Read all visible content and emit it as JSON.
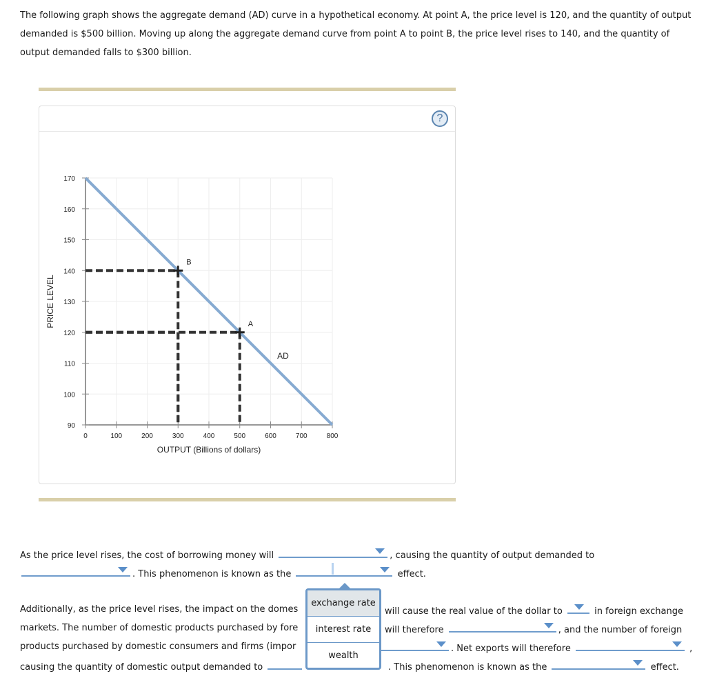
{
  "intro": {
    "lines": [
      "The following graph shows the aggregate demand (AD) curve in a hypothetical economy. At point A, the price level is 120, and the quantity of output",
      "demanded is $500 billion. Moving up along the aggregate demand curve from point A to point B, the price level rises to 140, and the quantity of",
      "output demanded falls to $300 billion."
    ]
  },
  "graph": {
    "help_icon": "question-circle-icon",
    "help_label": "?"
  },
  "chart_data": {
    "type": "line",
    "title": "",
    "xlabel": "OUTPUT (Billions of dollars)",
    "ylabel": "PRICE LEVEL",
    "xlim": [
      0,
      800
    ],
    "ylim": [
      90,
      170
    ],
    "x_ticks": [
      0,
      100,
      200,
      300,
      400,
      500,
      600,
      700,
      800
    ],
    "y_ticks": [
      90,
      100,
      110,
      120,
      130,
      140,
      150,
      160,
      170
    ],
    "grid": true,
    "series": [
      {
        "name": "AD",
        "label": "AD",
        "color": "#86aad1",
        "x": [
          0,
          800
        ],
        "y": [
          170,
          90
        ],
        "label_at": [
          640,
          111
        ]
      }
    ],
    "points": [
      {
        "name": "A",
        "x": 500,
        "y": 120
      },
      {
        "name": "B",
        "x": 300,
        "y": 140
      }
    ],
    "guides": [
      {
        "x": 300,
        "y": 140
      },
      {
        "x": 500,
        "y": 120
      },
      {
        "x": 300,
        "y": 120
      }
    ]
  },
  "question1": {
    "line1_pre": "As the price level rises, the cost of borrowing money will",
    "line1_post": ", causing the quantity of output demanded to",
    "line2_mid": ". This phenomenon is known as the",
    "line2_post": "effect.",
    "dropdowns": [
      {
        "id": "borrowing-cost",
        "value": ""
      },
      {
        "id": "quantity-demanded",
        "value": ""
      },
      {
        "id": "effect-name",
        "value": "",
        "open": true
      }
    ]
  },
  "popup": {
    "options": [
      "exchange rate",
      "interest rate",
      "wealth"
    ],
    "hovered": "exchange rate"
  },
  "question2": {
    "l1_pre": "Additionally, as the price level rises, the impact on the domes",
    "l1_mid": "will cause the real value of the dollar to",
    "l1_post": "in foreign exchange",
    "l2_pre": "markets. The number of domestic products purchased by fore",
    "l2_mid": "will therefore",
    "l2_post": ", and the number of foreign",
    "l3_pre": "products purchased by domestic consumers and firms (impor",
    "l3_mid": ". Net exports will therefore",
    "l3_post": ",",
    "l4_pre": "causing the quantity of domestic output demanded to",
    "l4_mid": ". This phenomenon is known as the",
    "l4_post": "effect."
  }
}
